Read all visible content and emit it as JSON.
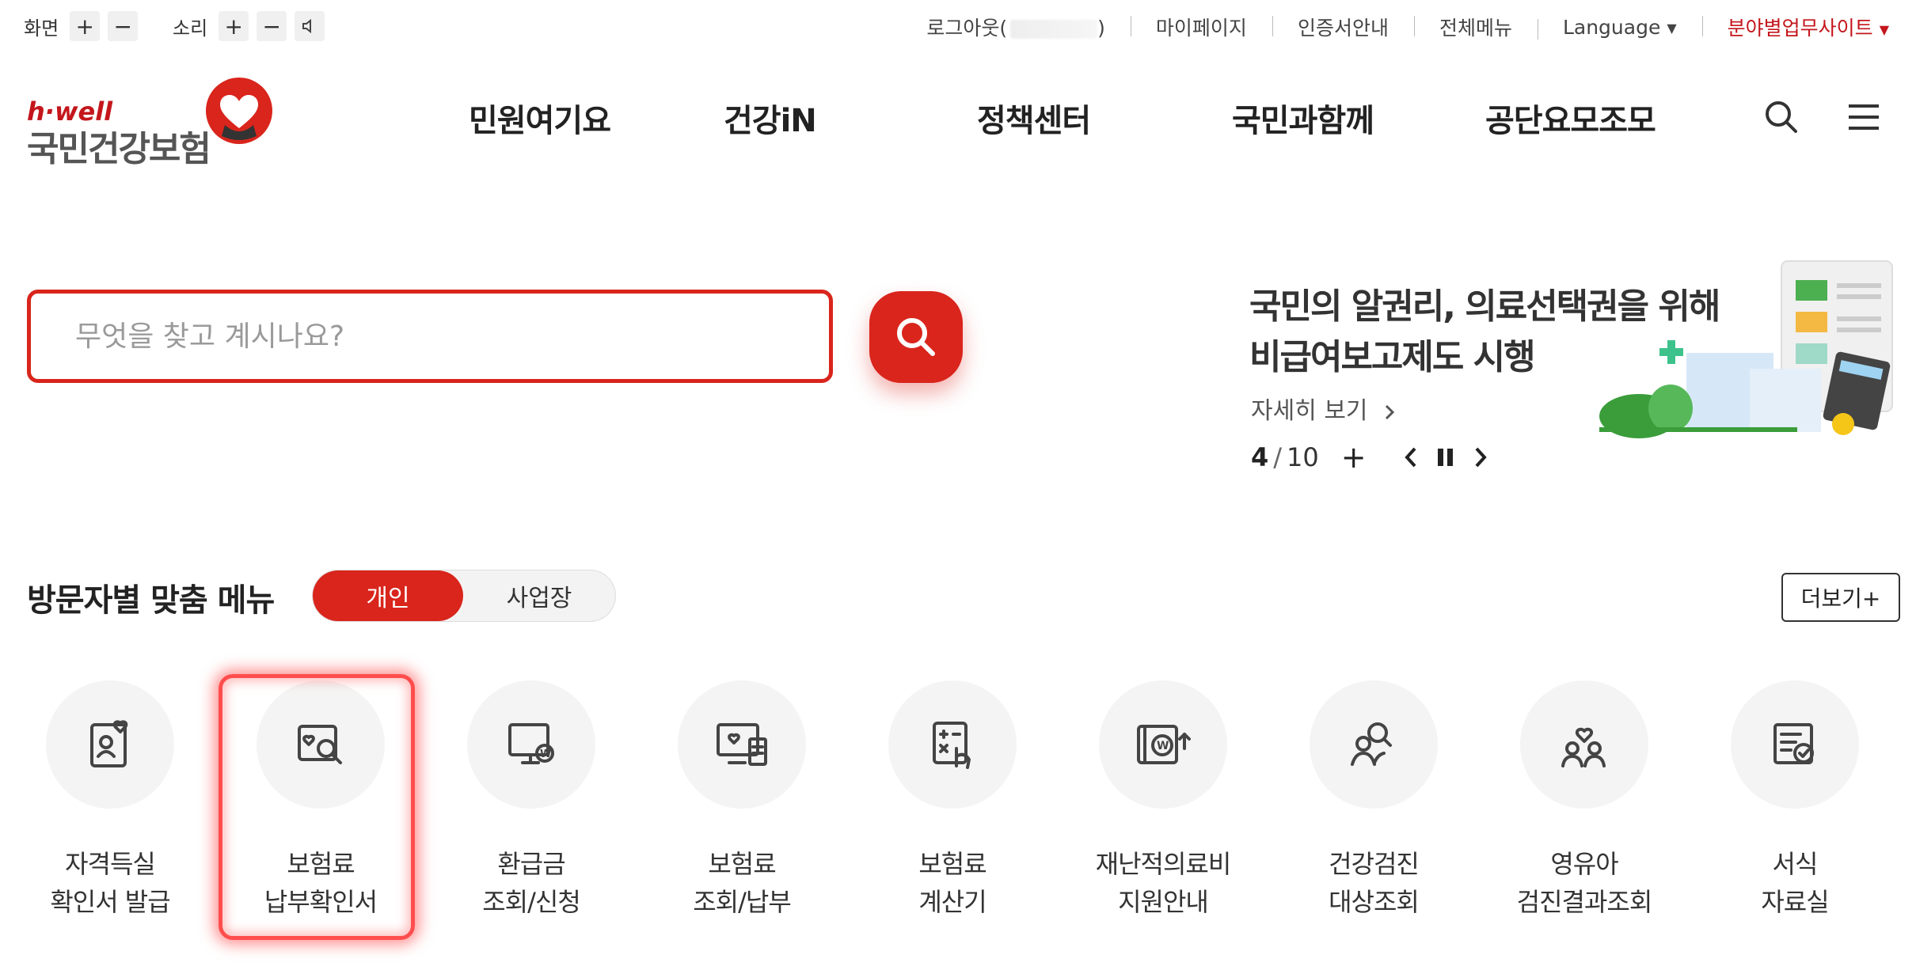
{
  "accessibility": {
    "screen_label": "화면",
    "sound_label": "소리",
    "plus": "+",
    "minus": "−",
    "speaker": "🔈"
  },
  "top_menu": {
    "logout": "로그아웃(",
    "logout_tail": ")",
    "mypage": "마이페이지",
    "cert_info": "인증서안내",
    "all_menu": "전체메뉴",
    "language": "Language",
    "field_sites": "분야별업무사이트"
  },
  "logo": {
    "brand": "h·well",
    "name": "국민건강보험"
  },
  "gnb": [
    "민원여기요",
    "건강iN",
    "정책센터",
    "국민과함께",
    "공단요모조모"
  ],
  "search": {
    "placeholder": "무엇을 찾고 계시나요?"
  },
  "banner": {
    "title_line1": "국민의 알권리, 의료선택권을 위해",
    "title_line2": "비급여보고제도 시행",
    "more": "자세히 보기",
    "current": "4",
    "separator": "/",
    "total": "10",
    "plus": "+"
  },
  "visitor_menu": {
    "title": "방문자별 맞춤 메뉴",
    "tab_personal": "개인",
    "tab_business": "사업장",
    "more": "더보기+",
    "items": [
      {
        "line1": "자격득실",
        "line2": "확인서 발급",
        "icon": "qualification-certificate-icon"
      },
      {
        "line1": "보험료",
        "line2": "납부확인서",
        "icon": "premium-payment-certificate-icon"
      },
      {
        "line1": "환급금",
        "line2": "조회/신청",
        "icon": "refund-monitor-icon"
      },
      {
        "line1": "보험료",
        "line2": "조회/납부",
        "icon": "premium-inquiry-icon"
      },
      {
        "line1": "보험료",
        "line2": "계산기",
        "icon": "calculator-icon"
      },
      {
        "line1": "재난적의료비",
        "line2": "지원안내",
        "icon": "medical-cost-support-icon"
      },
      {
        "line1": "건강검진",
        "line2": "대상조회",
        "icon": "checkup-target-icon"
      },
      {
        "line1": "영유아",
        "line2": "검진결과조회",
        "icon": "infant-checkup-icon"
      },
      {
        "line1": "서식",
        "line2": "자료실",
        "icon": "forms-library-icon"
      }
    ]
  },
  "colors": {
    "brand_red": "#d9251c",
    "highlight": "#ff4d4d"
  }
}
